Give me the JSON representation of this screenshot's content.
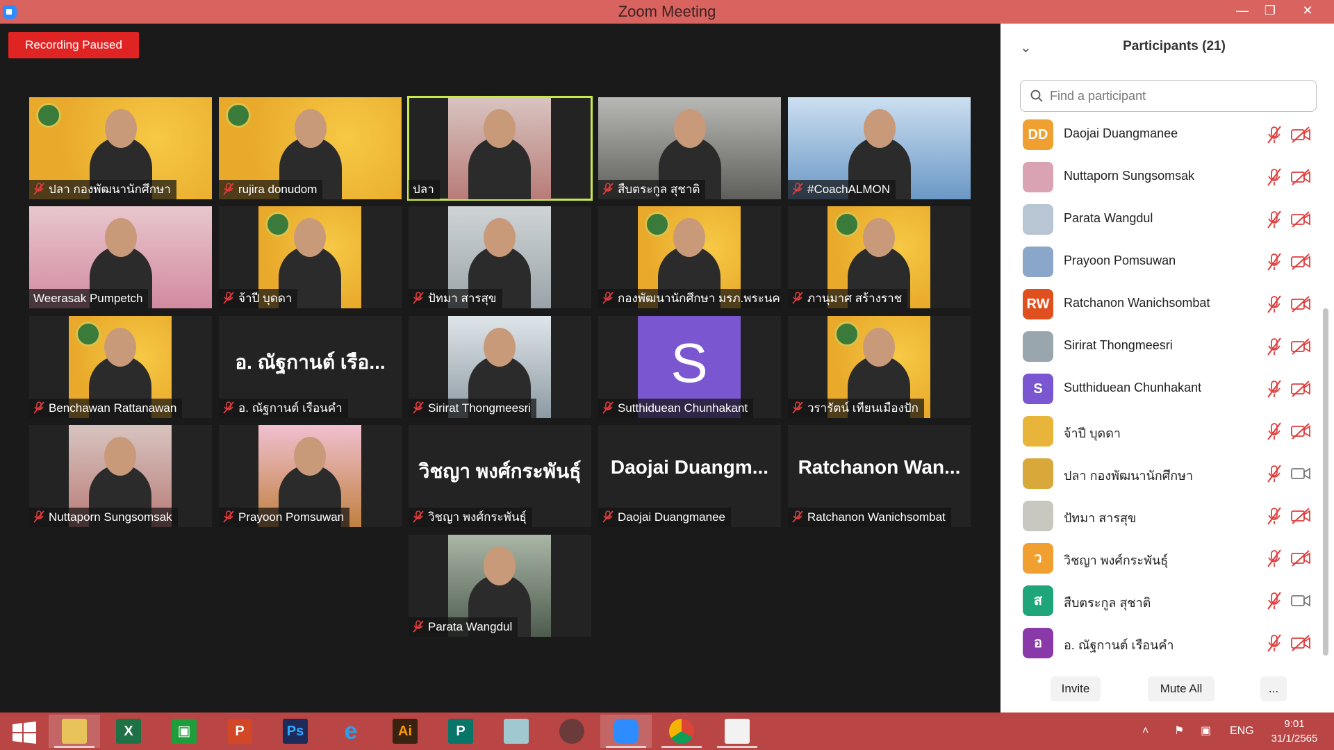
{
  "window": {
    "title": "Zoom Meeting",
    "controls": [
      "minimize-icon",
      "restore-icon",
      "close-icon"
    ]
  },
  "recording_badge": "Recording Paused",
  "video_tiles": [
    {
      "name": "ปลา กองพัฒนานักศึกษา",
      "muted": true,
      "view": "video"
    },
    {
      "name": "rujira donudom",
      "muted": true,
      "view": "video"
    },
    {
      "name": "ปลา",
      "muted": false,
      "view": "video",
      "active_speaker": true
    },
    {
      "name": "สืบตระกูล สุชาติ",
      "muted": true,
      "view": "video"
    },
    {
      "name": "#CoachALMON",
      "muted": true,
      "view": "video"
    },
    {
      "name": "Weerasak Pumpetch",
      "muted": false,
      "view": "video"
    },
    {
      "name": "จ้าปี บุดดา",
      "muted": true,
      "view": "video"
    },
    {
      "name": "ปัทมา สารสุข",
      "muted": true,
      "view": "video"
    },
    {
      "name": "กองพัฒนานักศึกษา มรภ.พระนคร",
      "muted": true,
      "view": "video"
    },
    {
      "name": "ภานุมาศ สร้างราช",
      "muted": true,
      "view": "video"
    },
    {
      "name": "Benchawan Rattanawan",
      "muted": true,
      "view": "video"
    },
    {
      "name": "อ. ณัฐกานต์ เรือนคำ",
      "muted": true,
      "view": "text",
      "display_text": "อ. ณัฐกานต์ เรือ..."
    },
    {
      "name": "Sirirat Thongmeesri",
      "muted": true,
      "view": "video"
    },
    {
      "name": "Sutthiduean Chunhakant",
      "muted": true,
      "view": "letter",
      "display_text": "S"
    },
    {
      "name": "วรารัตน์ เทียนเมืองปัก",
      "muted": true,
      "view": "video"
    },
    {
      "name": "Nuttaporn Sungsomsak",
      "muted": true,
      "view": "video"
    },
    {
      "name": "Prayoon Pomsuwan",
      "muted": true,
      "view": "video"
    },
    {
      "name": "วิชญา พงศ์กระพันธุ์",
      "muted": true,
      "view": "text",
      "display_text": "วิชญา พงศ์กระพันธุ์"
    },
    {
      "name": "Daojai Duangmanee",
      "muted": true,
      "view": "text",
      "display_text": "Daojai Duangm..."
    },
    {
      "name": "Ratchanon Wanichsombat",
      "muted": true,
      "view": "text",
      "display_text": "Ratchanon Wan..."
    },
    {
      "name": "Parata Wangdul",
      "muted": true,
      "view": "video"
    }
  ],
  "panel": {
    "title": "Participants (21)",
    "search_placeholder": "Find a participant",
    "participants": [
      {
        "name": "Daojai Duangmanee",
        "avatar_text": "DD",
        "avatar_color": "#f0a030",
        "mic": "muted",
        "video": "off"
      },
      {
        "name": "Nuttaporn Sungsomsak",
        "avatar_text": "",
        "avatar_color": "#d9a3b3",
        "mic": "muted",
        "video": "off"
      },
      {
        "name": "Parata Wangdul",
        "avatar_text": "",
        "avatar_color": "#b8c6d4",
        "mic": "muted",
        "video": "off"
      },
      {
        "name": "Prayoon Pomsuwan",
        "avatar_text": "",
        "avatar_color": "#8aa6c8",
        "mic": "muted",
        "video": "off"
      },
      {
        "name": "Ratchanon Wanichsombat",
        "avatar_text": "RW",
        "avatar_color": "#e0501e",
        "mic": "muted",
        "video": "off"
      },
      {
        "name": "Sirirat Thongmeesri",
        "avatar_text": "",
        "avatar_color": "#9aa6ae",
        "mic": "muted",
        "video": "off"
      },
      {
        "name": "Sutthiduean Chunhakant",
        "avatar_text": "S",
        "avatar_color": "#7a57d1",
        "mic": "muted",
        "video": "off"
      },
      {
        "name": "จ้าปี บุดดา",
        "avatar_text": "",
        "avatar_color": "#e8b53a",
        "mic": "muted",
        "video": "off"
      },
      {
        "name": "ปลา กองพัฒนานักศึกษา",
        "avatar_text": "",
        "avatar_color": "#d8a83a",
        "mic": "muted",
        "video": "on"
      },
      {
        "name": "ปัทมา สารสุข",
        "avatar_text": "",
        "avatar_color": "#c8c8c0",
        "mic": "muted",
        "video": "off"
      },
      {
        "name": "วิชญา พงศ์กระพันธุ์",
        "avatar_text": "ว",
        "avatar_color": "#f0a030",
        "mic": "muted",
        "video": "off"
      },
      {
        "name": "สืบตระกูล สุชาติ",
        "avatar_text": "ส",
        "avatar_color": "#1fa57a",
        "mic": "muted",
        "video": "on"
      },
      {
        "name": "อ. ณัฐกานต์ เรือนคำ",
        "avatar_text": "อ",
        "avatar_color": "#8a3aa8",
        "mic": "muted",
        "video": "off"
      }
    ],
    "footer": {
      "invite": "Invite",
      "mute_all": "Mute All",
      "more": "..."
    }
  },
  "taskbar": {
    "apps": [
      "start-icon",
      "file-explorer-icon",
      "excel-icon",
      "store-icon",
      "powerpoint-icon",
      "photoshop-icon",
      "edge-icon",
      "illustrator-icon",
      "publisher-icon",
      "notes-icon",
      "photoscape-icon",
      "zoom-icon",
      "chrome-icon",
      "office-icon"
    ],
    "app_glyphs": {
      "excel": "X",
      "powerpoint": "P",
      "photoshop": "Ps",
      "illustrator": "Ai",
      "publisher": "P",
      "store": "▣"
    },
    "language": "ENG",
    "time": "9:01",
    "date": "31/1/2565"
  },
  "colors": {
    "titlebar": "#d9635f",
    "taskbar": "#b94545",
    "recording": "#e02424",
    "active_speaker": "#c9e84b",
    "muted_red": "#e03c3c"
  }
}
